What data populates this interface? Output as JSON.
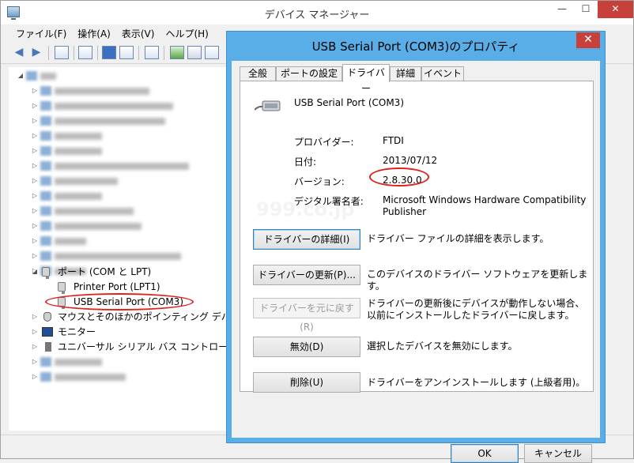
{
  "main_window": {
    "title": "デバイス マネージャー",
    "menu": [
      "ファイル(F)",
      "操作(A)",
      "表示(V)",
      "ヘルプ(H)"
    ],
    "tree": {
      "ports_label": "ポート (COM と LPT)",
      "printer_port": "Printer Port (LPT1)",
      "usb_serial": "USB Serial Port (COM3)",
      "mice": "マウスとそのほかのポインティング デバイス",
      "monitors": "モニター",
      "usb_controllers": "ユニバーサル シリアル バス コントローラー"
    }
  },
  "dialog": {
    "title": "USB Serial Port (COM3)のプロパティ",
    "tabs": [
      "全般",
      "ポートの設定",
      "ドライバー",
      "詳細",
      "イベント"
    ],
    "active_tab": "ドライバー",
    "device_name": "USB Serial Port (COM3)",
    "info": {
      "provider_label": "プロバイダー:",
      "provider_value": "FTDI",
      "date_label": "日付:",
      "date_value": "2013/07/12",
      "version_label": "バージョン:",
      "version_value": "2.8.30.0",
      "signer_label": "デジタル署名者:",
      "signer_value": "Microsoft Windows Hardware Compatibility Publisher"
    },
    "actions": [
      {
        "label": "ドライバーの詳細(I)",
        "desc": "ドライバー ファイルの詳細を表示します。"
      },
      {
        "label": "ドライバーの更新(P)...",
        "desc": "このデバイスのドライバー ソフトウェアを更新します。"
      },
      {
        "label": "ドライバーを元に戻す(R)",
        "desc": "ドライバーの更新後にデバイスが動作しない場合、以前にインストールしたドライバーに戻します。"
      },
      {
        "label": "無効(D)",
        "desc": "選択したデバイスを無効にします。"
      },
      {
        "label": "削除(U)",
        "desc": "ドライバーをアンインストールします (上級者用)。"
      }
    ],
    "ok_label": "OK",
    "cancel_label": "キャンセル"
  },
  "watermark": "999.co.jp",
  "colors": {
    "accent": "#5aaee8",
    "close": "#c7413a",
    "highlight_ellipse": "#e0201b"
  }
}
